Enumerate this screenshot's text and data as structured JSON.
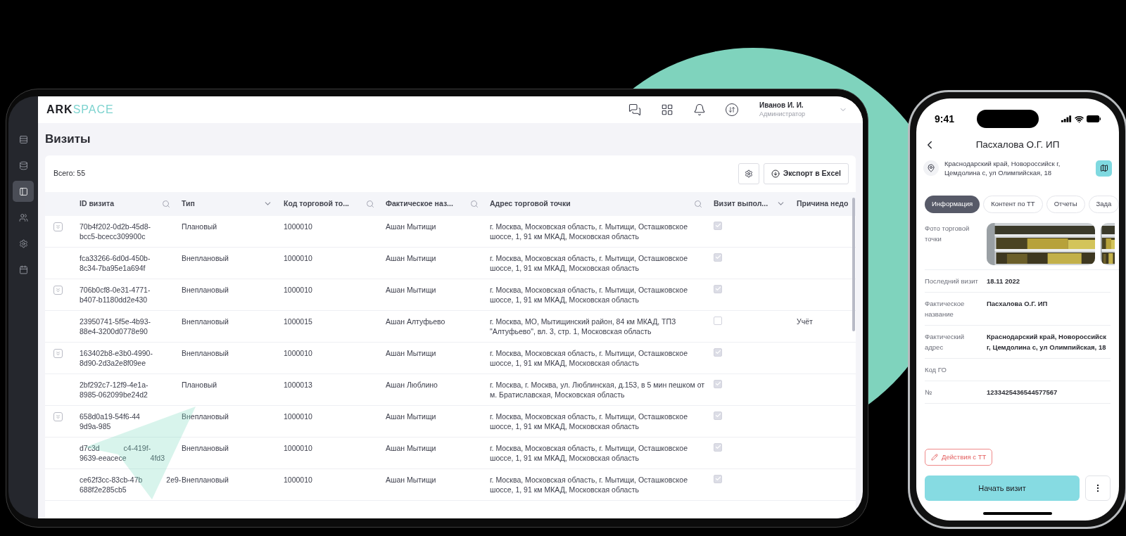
{
  "app": {
    "logo_dark": "ARK",
    "logo_accent": "SPACE"
  },
  "sidebar": {
    "items": [
      {
        "kind": "list",
        "selected": false
      },
      {
        "kind": "database",
        "selected": false
      },
      {
        "kind": "panel",
        "selected": true
      },
      {
        "kind": "users",
        "selected": false
      },
      {
        "kind": "settings",
        "selected": false
      },
      {
        "kind": "calendar",
        "selected": false
      }
    ]
  },
  "topbar": {
    "icons": [
      {
        "kind": "help"
      },
      {
        "kind": "apps"
      },
      {
        "kind": "bell"
      },
      {
        "kind": "swap"
      }
    ],
    "user": {
      "name": "Иванов И. И.",
      "role": "Администратор"
    }
  },
  "page": {
    "title": "Визиты",
    "total": "Всего: 55",
    "export_button": "Экспорт в Excel"
  },
  "table": {
    "columns": [
      {
        "label": "ID визита",
        "kind": "search"
      },
      {
        "label": "Тип",
        "kind": "select"
      },
      {
        "label": "Код торговой то...",
        "kind": "search"
      },
      {
        "label": "Фактическое наз...",
        "kind": "search"
      },
      {
        "label": "Адрес торговой точки",
        "kind": "search"
      },
      {
        "label": "Визит выпол...",
        "kind": "select"
      },
      {
        "label": "Причина недо",
        "kind": "plain"
      }
    ],
    "rows": [
      {
        "expandable": true,
        "id": "70b4f202-0d2b-45d8-bcc5-bcecc309900c",
        "type": "Плановый",
        "code": "1000010",
        "name": "Ашан Мытищи",
        "address": "г. Москва, Московская область, г. Мытищи, Осташковское шоссе, 1, 91 км МКАД, Московская область",
        "done": true
      },
      {
        "expandable": false,
        "id": "fca33266-6d0d-450b-8c34-7ba95e1a694f",
        "type": "Внеплановый",
        "code": "1000010",
        "name": "Ашан Мытищи",
        "address": "г. Москва, Московская область, г. Мытищи, Осташковское шоссе, 1, 91 км МКАД, Московская область",
        "done": true
      },
      {
        "expandable": true,
        "id": "706b0cf8-0e31-4771-b407-b1180dd2e430",
        "type": "Внеплановый",
        "code": "1000010",
        "name": "Ашан Мытищи",
        "address": "г. Москва, Московская область, г. Мытищи, Осташковское шоссе, 1, 91 км МКАД, Московская область",
        "done": true
      },
      {
        "expandable": false,
        "id": "23950741-5f5e-4b93-88e4-3200d0778e90",
        "type": "Внеплановый",
        "code": "1000015",
        "name": "Ашан Алтуфьево",
        "address": "г. Москва, МО, Мытищинский район, 84 км МКАД, ТПЗ \"Алтуфьево\", вл. 3, стр. 1, Московская область",
        "done": false,
        "reason": "Учёт"
      },
      {
        "expandable": true,
        "id": "163402b8-e3b0-4990-8d90-2d3a2e8f09ee",
        "type": "Внеплановый",
        "code": "1000010",
        "name": "Ашан Мытищи",
        "address": "г. Москва, Московская область, г. Мытищи, Осташковское шоссе, 1, 91 км МКАД, Московская область",
        "done": true
      },
      {
        "expandable": false,
        "id": "2bf292c7-12f9-4e1a-8985-062099be24d2",
        "type": "Плановый",
        "code": "1000013",
        "name": "Ашан Люблино",
        "address": "г. Москва, г. Москва, ул. Люблинская, д.153, в 5 мин пешком от м. Братиславская, Московская область",
        "done": true
      },
      {
        "expandable": true,
        "id_parts": [
          [
            "658d0a19-54f6-44"
          ],
          [
            "9d9a-985"
          ]
        ],
        "type": "Внеплановый",
        "code": "1000010",
        "name": "Ашан Мытищи",
        "address": "г. Москва, Московская область, г. Мытищи, Осташковское шоссе, 1, 91 км МКАД, Московская область",
        "done": true
      },
      {
        "expandable": false,
        "id_parts": [
          [
            "d7c3d",
            "c4-419f-"
          ],
          [
            "9639-eeacece",
            "4fd3"
          ]
        ],
        "type": "Внеплановый",
        "code": "1000010",
        "name": "Ашан Мытищи",
        "address": "г. Москва, Московская область, г. Мытищи, Осташковское шоссе, 1, 91 км МКАД, Московская область",
        "done": true
      },
      {
        "expandable": false,
        "id_parts": [
          [
            "ce62f3cc-83cb-47b",
            "2e9-"
          ],
          [
            "688f2e285cb5"
          ]
        ],
        "type": "Внеплановый",
        "code": "1000010",
        "name": "Ашан Мытищи",
        "address": "г. Москва, Московская область, г. Мытищи, Осташковское шоссе, 1, 91 км МКАД, Московская область",
        "done": true
      }
    ]
  },
  "phone": {
    "time": "9:41",
    "title": "Пасхалова О.Г. ИП",
    "address": "Краснодарский край, Новороссийск г, Цемдолина с, ул Олимпийская, 18",
    "tabs": [
      {
        "label": "Информация",
        "selected": true
      },
      {
        "label": "Контент по ТТ",
        "selected": false
      },
      {
        "label": "Отчеты",
        "selected": false
      },
      {
        "label": "Зада",
        "selected": false
      }
    ],
    "fields": [
      {
        "label": "Фото торговой точки"
      },
      {
        "kind": "text",
        "label": "Последний визит",
        "value": "18.11 2022"
      },
      {
        "kind": "text",
        "label": "Фактическое название",
        "value": "Пасхалова О.Г. ИП"
      },
      {
        "kind": "text",
        "label": "Фактический адрес",
        "value": "Краснодарский край, Новороссийск г, Цемдолина с, ул Олимпийская, 18"
      },
      {
        "kind": "text",
        "label": "Код ГО"
      },
      {
        "kind": "text",
        "label": "№",
        "value": "1233425436544577567"
      }
    ],
    "actions_button": "Действия с ТТ",
    "start_button": "Начать визит"
  }
}
